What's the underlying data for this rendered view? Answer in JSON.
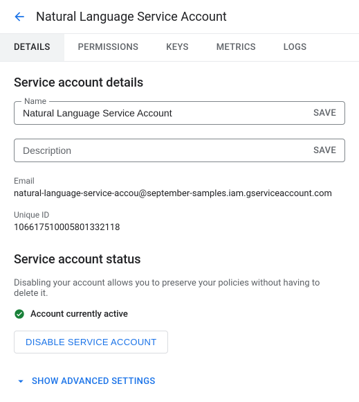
{
  "header": {
    "title": "Natural Language Service Account"
  },
  "tabs": [
    {
      "label": "DETAILS",
      "active": true
    },
    {
      "label": "PERMISSIONS",
      "active": false
    },
    {
      "label": "KEYS",
      "active": false
    },
    {
      "label": "METRICS",
      "active": false
    },
    {
      "label": "LOGS",
      "active": false
    }
  ],
  "details": {
    "section_title": "Service account details",
    "name_label": "Name",
    "name_value": "Natural Language Service Account",
    "name_save": "SAVE",
    "description_placeholder": "Description",
    "description_value": "",
    "description_save": "SAVE",
    "email_label": "Email",
    "email_value": "natural-language-service-accou@september-samples.iam.gserviceaccount.com",
    "uniqueid_label": "Unique ID",
    "uniqueid_value": "106617510005801332118"
  },
  "status": {
    "section_title": "Service account status",
    "description": "Disabling your account allows you to preserve your policies without having to delete it.",
    "active_text": "Account currently active",
    "disable_button": "DISABLE SERVICE ACCOUNT"
  },
  "advanced": {
    "label": "SHOW ADVANCED SETTINGS"
  }
}
